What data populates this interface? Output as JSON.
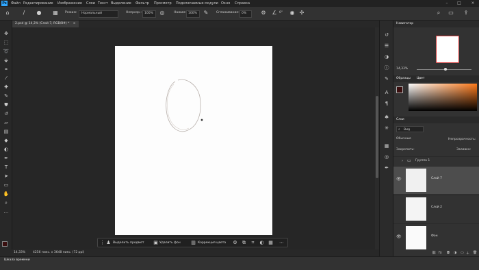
{
  "menu": {
    "logo": "Ps",
    "items": [
      "Файл",
      "Редактирование",
      "Изображение",
      "Слои",
      "Текст",
      "Выделение",
      "Фильтр",
      "Просмотр",
      "Подключаемые модули",
      "Окно",
      "Справка"
    ]
  },
  "options": {
    "mode_label": "Режим:",
    "mode_value": "Нормальный",
    "opacity_label": "Непрозр.:",
    "opacity_value": "100%",
    "flow_label": "Нажим:",
    "flow_value": "100%",
    "smoothing_label": "Сглаживание:",
    "smoothing_value": "0%",
    "angle_value": "0°"
  },
  "document": {
    "tab_title": "2.psd @ 14,3% (Слой 7, RGB/8#) *",
    "close": "×"
  },
  "context_bar": {
    "select_subject": "Выделить предмет",
    "remove_bg": "Удалить фон",
    "fill_color": "Коррекция цвета"
  },
  "status": {
    "zoom": "14,33%",
    "doc_info": "4256 пикс. x 3648 пикс. (72 ppi)"
  },
  "timeline": {
    "title": "Шкала времени"
  },
  "navigator": {
    "title": "Навигатор",
    "zoom": "14,33%"
  },
  "color": {
    "tab_samples": "Образцы",
    "tab_color": "Цвет",
    "fg": "#3a0f0f",
    "bg": "#ffffff",
    "accent": "#ff7a1a"
  },
  "layers": {
    "title": "Слои",
    "search": "Вид",
    "blend": "Обычные",
    "opacity_label": "Непрозрачность:",
    "lock_label": "Закрепить:",
    "fill_label": "Заливка:",
    "group": "Группа 1",
    "items": [
      {
        "name": "Слой 7"
      },
      {
        "name": "Слой 2"
      },
      {
        "name": "Фон"
      }
    ]
  }
}
